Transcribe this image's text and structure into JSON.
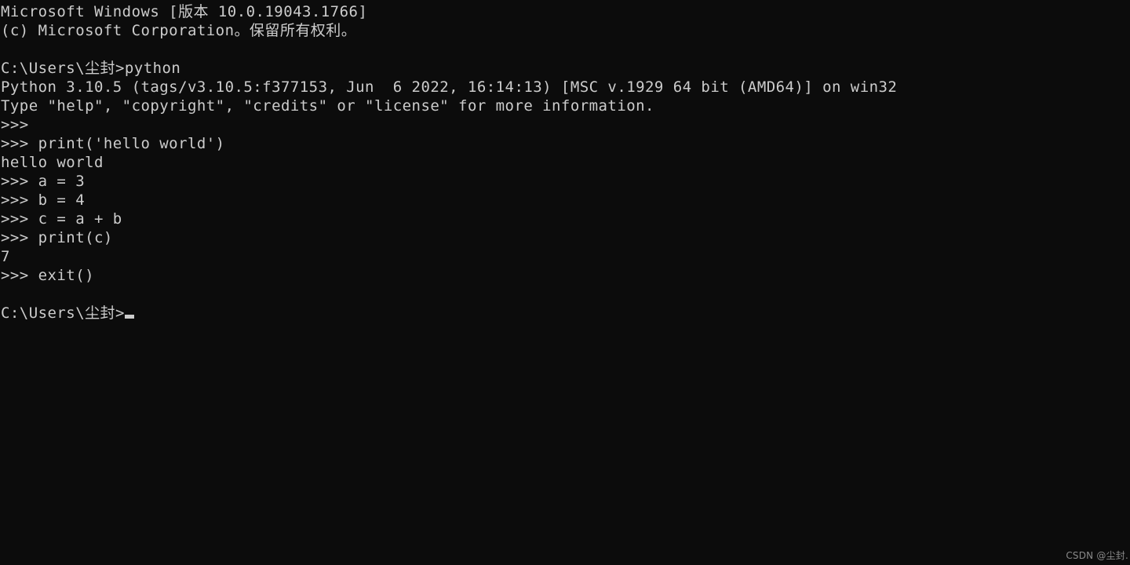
{
  "window": {
    "kind": "windows-command-prompt",
    "background_color": "#0c0c0c",
    "foreground_color": "#cccccc",
    "cursor_color": "#cccccc"
  },
  "terminal": {
    "lines": [
      "Microsoft Windows [版本 10.0.19043.1766]",
      "(c) Microsoft Corporation。保留所有权利。",
      "",
      "C:\\Users\\尘封>python",
      "Python 3.10.5 (tags/v3.10.5:f377153, Jun  6 2022, 16:14:13) [MSC v.1929 64 bit (AMD64)] on win32",
      "Type \"help\", \"copyright\", \"credits\" or \"license\" for more information.",
      ">>>",
      ">>> print('hello world')",
      "hello world",
      ">>> a = 3",
      ">>> b = 4",
      ">>> c = a + b",
      ">>> print(c)",
      "7",
      ">>> exit()",
      ""
    ],
    "final_prompt": "C:\\Users\\尘封>",
    "cursor": "block-underline"
  },
  "watermark": {
    "text": "CSDN @尘封.",
    "color": "#8a8a8a"
  }
}
